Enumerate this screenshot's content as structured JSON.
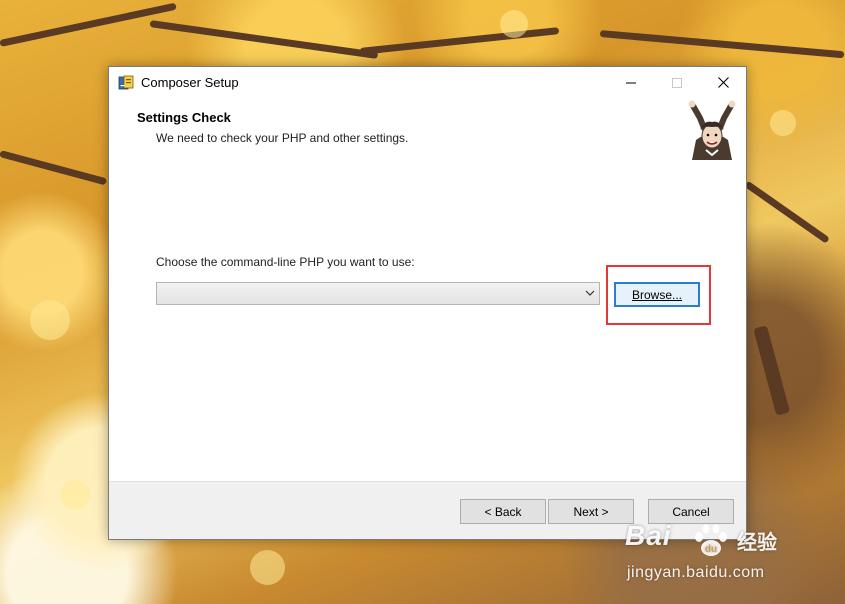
{
  "window": {
    "title": "Composer Setup",
    "controls": {
      "minimize": "minimize-icon",
      "maximize": "maximize-icon",
      "close": "close-icon"
    }
  },
  "header": {
    "title": "Settings Check",
    "subtitle": "We need to check your PHP and other settings."
  },
  "content": {
    "choose_label": "Choose the command-line PHP you want to use:",
    "php_select_value": "",
    "browse_label": "Browse..."
  },
  "footer": {
    "back_label": "< Back",
    "next_label": "Next >",
    "cancel_label": "Cancel"
  },
  "watermark": {
    "brand": "Bai",
    "cn": "经验",
    "url": "jingyan.baidu.com"
  },
  "colors": {
    "highlight": "#e53935",
    "focus_border": "#2a7bd4",
    "footer_bg": "#f0f0f0"
  }
}
